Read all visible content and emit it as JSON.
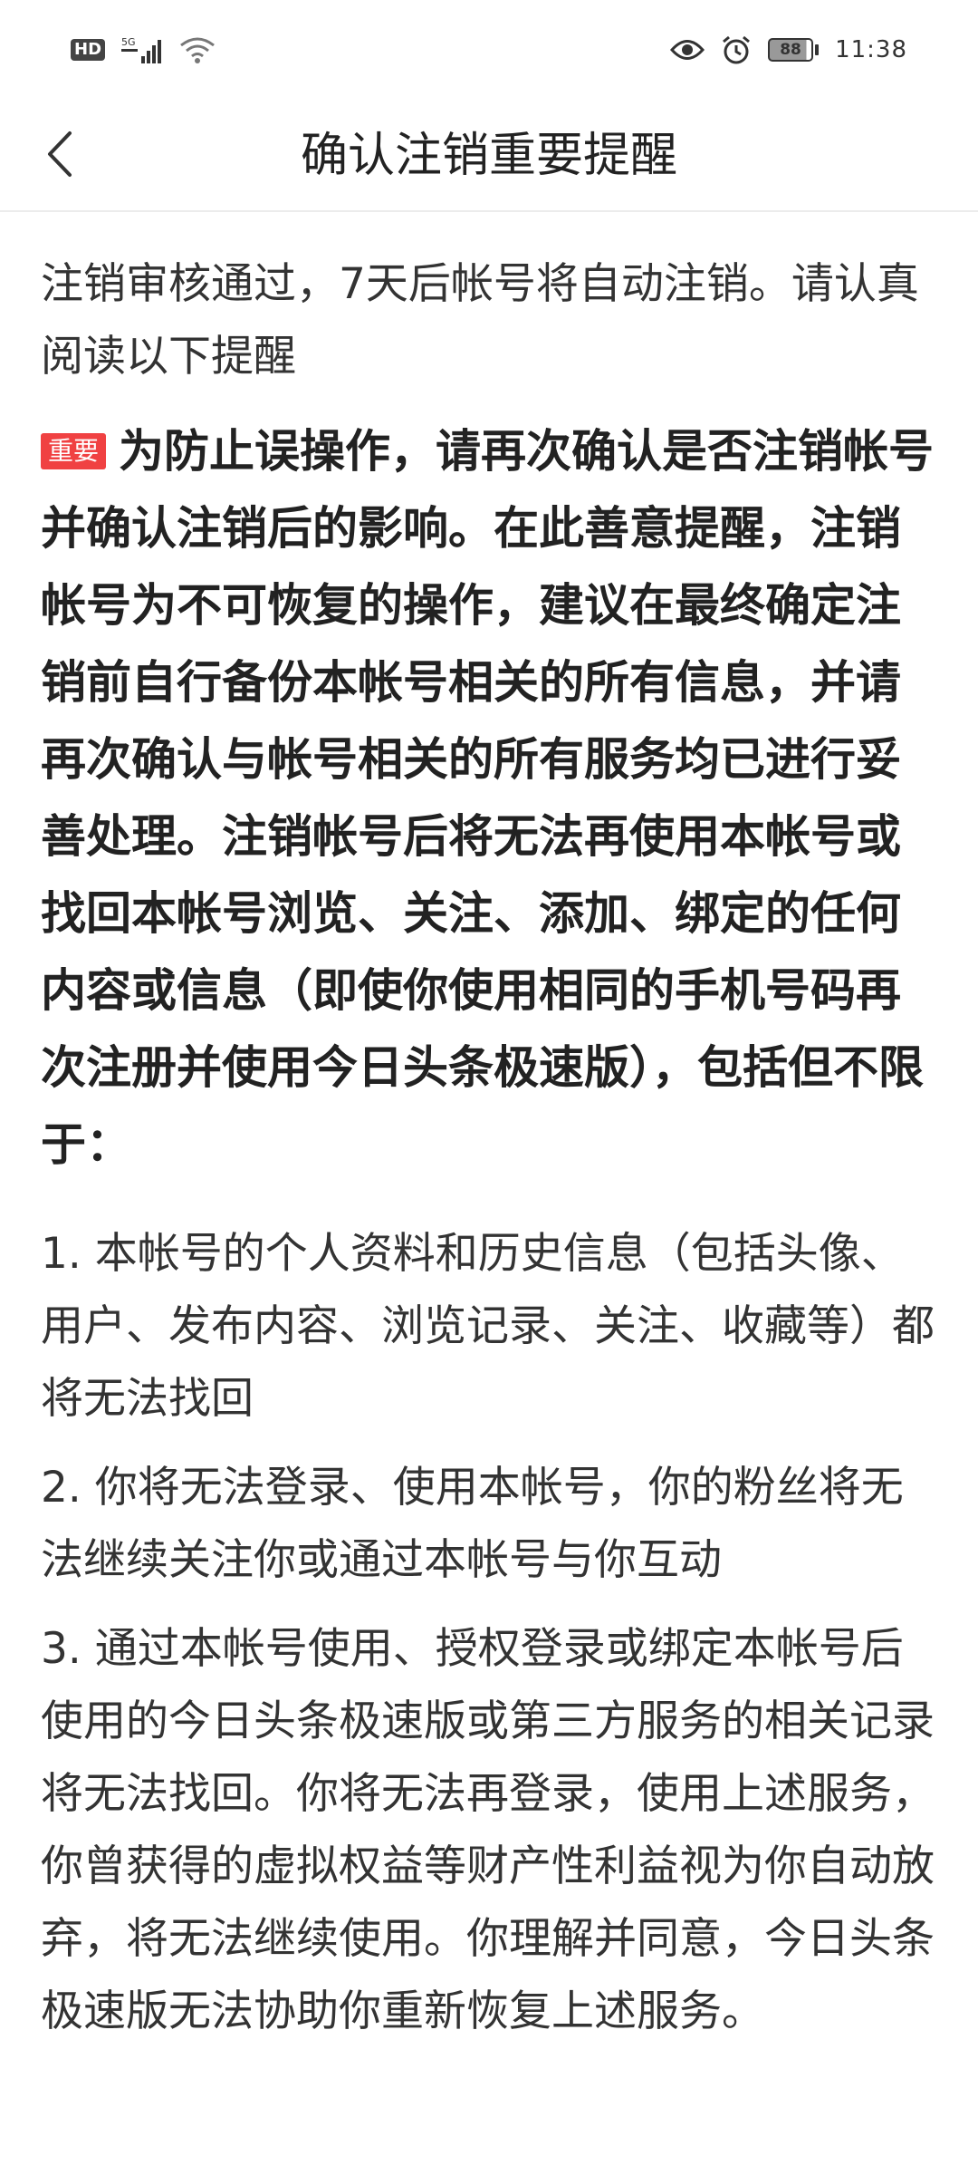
{
  "status_bar": {
    "hd": "HD",
    "network": "5G",
    "battery": "88",
    "time": "11:38"
  },
  "header": {
    "title": "确认注销重要提醒"
  },
  "intro": "注销审核通过，7天后帐号将自动注销。请认真阅读以下提醒",
  "important": {
    "badge": "重要",
    "text": "为防止误操作，请再次确认是否注销帐号并确认注销后的影响。在此善意提醒，注销帐号为不可恢复的操作，建议在最终确定注销前自行备份本帐号相关的所有信息，并请再次确认与帐号相关的所有服务均已进行妥善处理。注销帐号后将无法再使用本帐号或找回本帐号浏览、关注、添加、绑定的任何内容或信息（即使你使用相同的手机号码再次注册并使用今日头条极速版），包括但不限于："
  },
  "items": [
    "1. 本帐号的个人资料和历史信息（包括头像、用户、发布内容、浏览记录、关注、收藏等）都将无法找回",
    "2. 你将无法登录、使用本帐号，你的粉丝将无法继续关注你或通过本帐号与你互动",
    "3. 通过本帐号使用、授权登录或绑定本帐号后使用的今日头条极速版或第三方服务的相关记录将无法找回。你将无法再登录，使用上述服务，你曾获得的虚拟权益等财产性利益视为你自动放弃，将无法继续使用。你理解并同意，今日头条极速版无法协助你重新恢复上述服务。"
  ]
}
